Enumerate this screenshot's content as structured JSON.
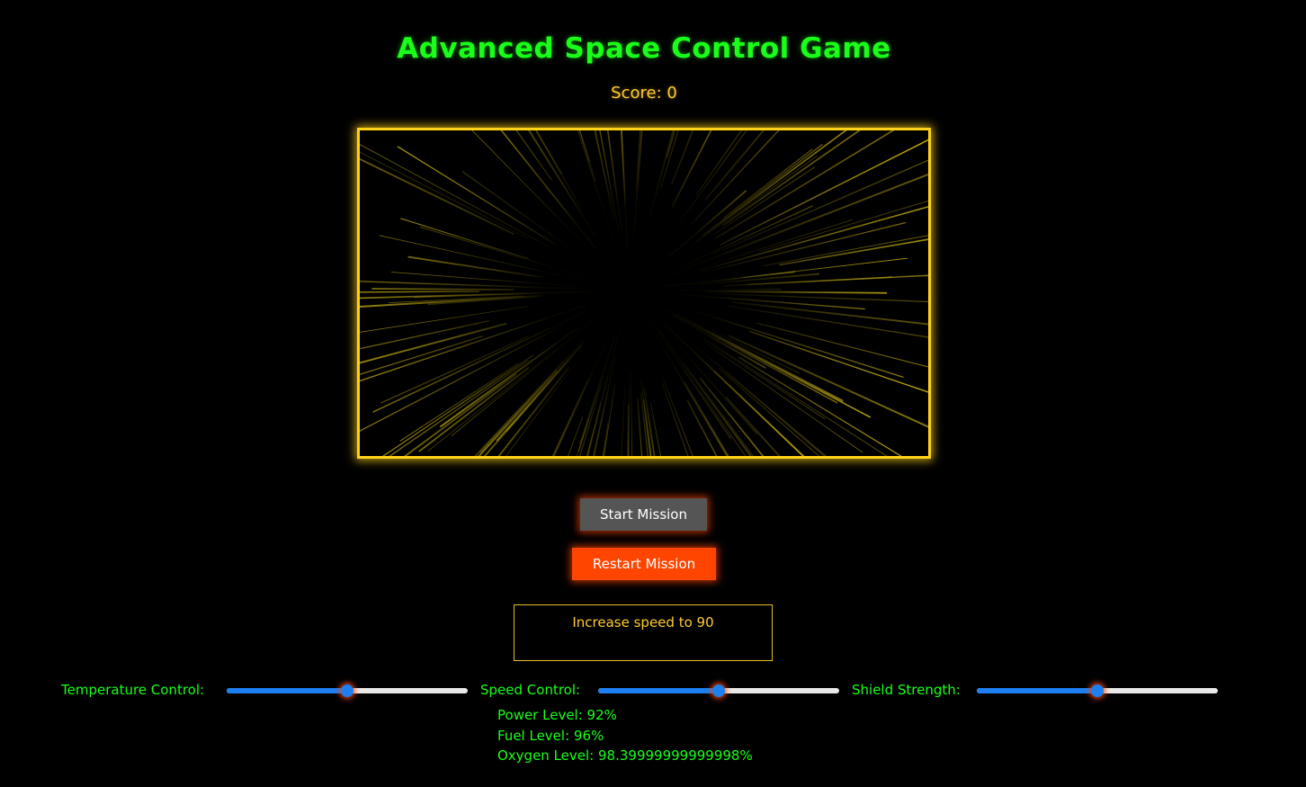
{
  "title": "Advanced Space Control Game",
  "score_text": "Score: 0",
  "buttons": {
    "start_label": "Start Mission",
    "restart_label": "Restart Mission"
  },
  "mission_text": "Increase speed to 90",
  "controls": [
    {
      "label": "Temperature Control:",
      "value": 0.5
    },
    {
      "label": "Speed Control:",
      "value": 0.5
    },
    {
      "label": "Shield Strength:",
      "value": 0.5
    }
  ],
  "status": {
    "power": "Power Level: 92%",
    "fuel": "Fuel Level: 96%",
    "oxygen": "Oxygen Level: 98.39999999999998%"
  },
  "colors": {
    "title": "#19ff19",
    "score": "#ffcc33",
    "frame": "#ffd21a",
    "restart": "#ff4500",
    "start": "#555555",
    "slider_fill": "#1e7ff0"
  }
}
